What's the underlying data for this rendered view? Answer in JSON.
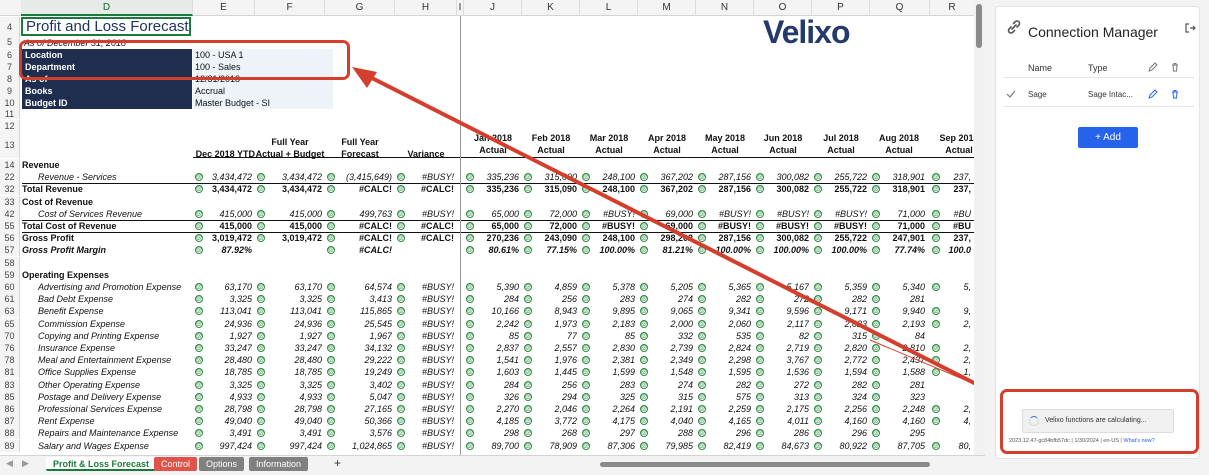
{
  "title": "Profit and Loss Forecast",
  "as_of": "As of December 31, 2018",
  "logo": "Velixo",
  "columns": [
    "D",
    "E",
    "F",
    "G",
    "H",
    "I",
    "J",
    "K",
    "L",
    "M",
    "N",
    "O",
    "P",
    "Q",
    "R"
  ],
  "params": [
    {
      "row": "6",
      "label": "Location",
      "value": "100 - USA 1"
    },
    {
      "row": "7",
      "label": "Department",
      "value": "100 - Sales"
    },
    {
      "row": "8",
      "label": "As of",
      "value": "12/31/2018"
    },
    {
      "row": "9",
      "label": "Books",
      "value": "Accrual"
    },
    {
      "row": "10",
      "label": "Budget ID",
      "value": "Master Budget - SI"
    }
  ],
  "header": {
    "row_top": "12",
    "row_bottom": "13",
    "dec_ytd": "Dec 2018 YTD",
    "fy_actual_budget": [
      "Full Year",
      "Actual + Budget"
    ],
    "fy_forecast": [
      "Full Year",
      "Forecast"
    ],
    "variance": "Variance",
    "months": [
      "Jan 2018",
      "Feb 2018",
      "Mar 2018",
      "Apr 2018",
      "May 2018",
      "Jun 2018",
      "Jul 2018",
      "Aug 2018",
      "Sep 2018"
    ],
    "actual": "Actual"
  },
  "rows": [
    {
      "n": "14",
      "label": "Revenue",
      "style": "b",
      "vals": []
    },
    {
      "n": "22",
      "label": "Revenue - Services",
      "style": "ind",
      "vals": [
        "3,434,472",
        "3,434,472",
        "(3,415,649)",
        "#BUSY!",
        "335,236",
        "315,090",
        "248,100",
        "367,202",
        "287,156",
        "300,082",
        "255,722",
        "318,901",
        "237,"
      ]
    },
    {
      "n": "32",
      "label": "Total Revenue",
      "style": "b",
      "vals": [
        "3,434,472",
        "3,434,472",
        "#CALC!",
        "#CALC!",
        "335,236",
        "315,090",
        "248,100",
        "367,202",
        "287,156",
        "300,082",
        "255,722",
        "318,901",
        "237,"
      ]
    },
    {
      "n": "33",
      "label": "Cost of Revenue",
      "style": "b",
      "vals": []
    },
    {
      "n": "42",
      "label": "Cost of Services Revenue",
      "style": "ind",
      "vals": [
        "415,000",
        "415,000",
        "499,763",
        "#BUSY!",
        "65,000",
        "72,000",
        "#BUSY!",
        "69,000",
        "#BUSY!",
        "#BUSY!",
        "#BUSY!",
        "71,000",
        "#BU"
      ]
    },
    {
      "n": "55",
      "label": "Total Cost of Revenue",
      "style": "b",
      "vals": [
        "415,000",
        "415,000",
        "#CALC!",
        "#CALC!",
        "65,000",
        "72,000",
        "#BUSY!",
        "69,000",
        "#BUSY!",
        "#BUSY!",
        "#BUSY!",
        "71,000",
        "#BU"
      ]
    },
    {
      "n": "56",
      "label": "Gross Profit",
      "style": "b",
      "vals": [
        "3,019,472",
        "3,019,472",
        "#CALC!",
        "#CALC!",
        "270,236",
        "243,090",
        "248,100",
        "298,202",
        "287,156",
        "300,082",
        "255,722",
        "247,901",
        "237,"
      ]
    },
    {
      "n": "57",
      "label": "Gross Profit Margin",
      "style": "bi",
      "vals": [
        "87.92%",
        "",
        "#CALC!",
        "",
        "80.61%",
        "77.15%",
        "100.00%",
        "81.21%",
        "100.00%",
        "100.00%",
        "100.00%",
        "77.74%",
        "100.0"
      ]
    },
    {
      "n": "58",
      "label": "",
      "style": "",
      "vals": []
    },
    {
      "n": "59",
      "label": "Operating Expenses",
      "style": "b",
      "vals": []
    },
    {
      "n": "60",
      "label": "Advertising and Promotion Expense",
      "style": "ind",
      "vals": [
        "63,170",
        "63,170",
        "64,574",
        "#BUSY!",
        "5,390",
        "4,859",
        "5,378",
        "5,205",
        "5,365",
        "5,167",
        "5,359",
        "5,340",
        "5,"
      ]
    },
    {
      "n": "61",
      "label": "Bad Debt Expense",
      "style": "ind",
      "vals": [
        "3,325",
        "3,325",
        "3,413",
        "#BUSY!",
        "284",
        "256",
        "283",
        "274",
        "282",
        "272",
        "282",
        "281",
        ""
      ]
    },
    {
      "n": "63",
      "label": "Benefit Expense",
      "style": "ind",
      "vals": [
        "113,041",
        "113,041",
        "115,865",
        "#BUSY!",
        "10,166",
        "8,943",
        "9,895",
        "9,065",
        "9,341",
        "9,596",
        "9,171",
        "9,940",
        "9,"
      ]
    },
    {
      "n": "65",
      "label": "Commission Expense",
      "style": "ind",
      "vals": [
        "24,936",
        "24,936",
        "25,545",
        "#BUSY!",
        "2,242",
        "1,973",
        "2,183",
        "2,000",
        "2,060",
        "2,117",
        "2,023",
        "2,193",
        "2,"
      ]
    },
    {
      "n": "70",
      "label": "Copying and Printing Expense",
      "style": "ind",
      "vals": [
        "1,927",
        "1,927",
        "1,967",
        "#BUSY!",
        "85",
        "77",
        "85",
        "332",
        "535",
        "82",
        "315",
        "84",
        ""
      ]
    },
    {
      "n": "76",
      "label": "Insurance Expense",
      "style": "ind",
      "vals": [
        "33,247",
        "33,247",
        "34,132",
        "#BUSY!",
        "2,837",
        "2,557",
        "2,830",
        "2,739",
        "2,824",
        "2,719",
        "2,820",
        "2,810",
        "2,"
      ]
    },
    {
      "n": "78",
      "label": "Meal and Entertainment Expense",
      "style": "ind",
      "vals": [
        "28,480",
        "28,480",
        "29,222",
        "#BUSY!",
        "1,541",
        "1,976",
        "2,381",
        "2,349",
        "2,298",
        "3,767",
        "2,772",
        "2,437",
        "2,"
      ]
    },
    {
      "n": "81",
      "label": "Office Supplies Expense",
      "style": "ind",
      "vals": [
        "18,785",
        "18,785",
        "19,249",
        "#BUSY!",
        "1,603",
        "1,445",
        "1,599",
        "1,548",
        "1,595",
        "1,536",
        "1,594",
        "1,588",
        "1,"
      ]
    },
    {
      "n": "83",
      "label": "Other Operating Expense",
      "style": "ind",
      "vals": [
        "3,325",
        "3,325",
        "3,402",
        "#BUSY!",
        "284",
        "256",
        "283",
        "274",
        "282",
        "272",
        "282",
        "281",
        ""
      ]
    },
    {
      "n": "85",
      "label": "Postage and Delivery Expense",
      "style": "ind",
      "vals": [
        "4,933",
        "4,933",
        "5,047",
        "#BUSY!",
        "326",
        "294",
        "325",
        "315",
        "575",
        "313",
        "324",
        "323",
        ""
      ]
    },
    {
      "n": "86",
      "label": "Professional Services Expense",
      "style": "ind",
      "vals": [
        "28,798",
        "28,798",
        "27,165",
        "#BUSY!",
        "2,270",
        "2,046",
        "2,264",
        "2,191",
        "2,259",
        "2,175",
        "2,256",
        "2,248",
        "2,"
      ]
    },
    {
      "n": "87",
      "label": "Rent Expense",
      "style": "ind",
      "vals": [
        "49,040",
        "49,040",
        "50,366",
        "#BUSY!",
        "4,185",
        "3,772",
        "4,175",
        "4,040",
        "4,165",
        "4,011",
        "4,160",
        "4,160",
        "4,"
      ]
    },
    {
      "n": "88",
      "label": "Repairs and Maintenance Expense",
      "style": "ind",
      "vals": [
        "3,491",
        "3,491",
        "3,576",
        "#BUSY!",
        "298",
        "268",
        "297",
        "288",
        "296",
        "286",
        "296",
        "295",
        ""
      ]
    },
    {
      "n": "89",
      "label": "Salary and Wages Expense",
      "style": "ind",
      "vals": [
        "997,424",
        "997,424",
        "1,024,865",
        "#BUSY!",
        "89,700",
        "78,909",
        "87,306",
        "79,985",
        "82,419",
        "84,673",
        "80,922",
        "87,705",
        "80,"
      ]
    }
  ],
  "tabs": [
    {
      "label": "Profit & Loss Forecast",
      "active": true,
      "color": "#ffffff"
    },
    {
      "label": "Control",
      "active": false,
      "color": "#e0534a"
    },
    {
      "label": "Options",
      "active": false,
      "color": "#808080"
    },
    {
      "label": "Information",
      "active": false,
      "color": "#808080"
    }
  ],
  "add_sheet": "+",
  "panel": {
    "title": "Connection Manager",
    "col_name": "Name",
    "col_type": "Type",
    "conn_name": "Sage",
    "conn_type": "Sage Intac...",
    "add_label": "Add",
    "calc_message": "Velixo functions are calculating...",
    "footer": "2023.12.47-gc84bfb57dc | 1/30/2024 | en-US |",
    "whats_new": "What's new?"
  },
  "accent_color": "#d43f2d"
}
